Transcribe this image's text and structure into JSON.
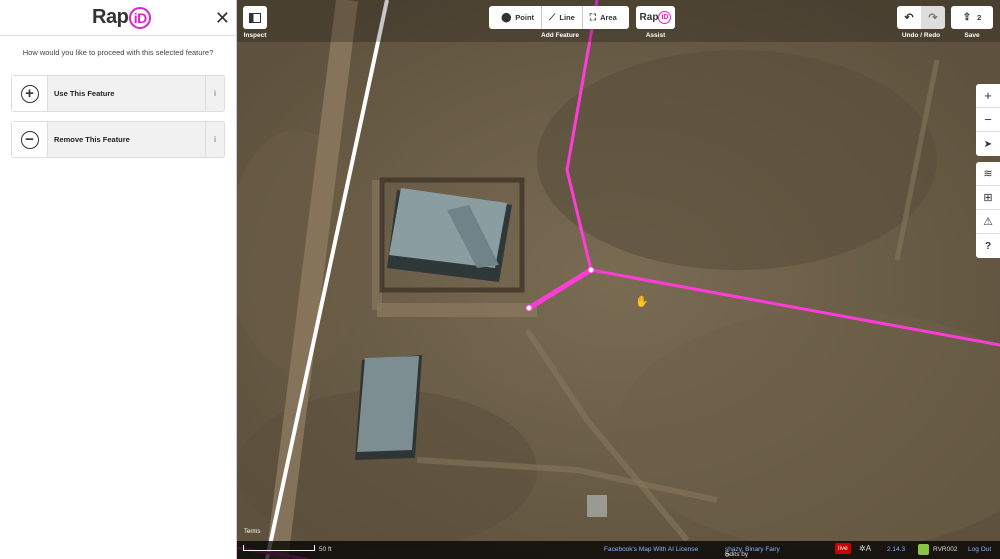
{
  "sidebar": {
    "logo_text": "Rap",
    "logo_id": "iD",
    "close_glyph": "✕",
    "prompt": "How would you like to proceed with this selected feature?",
    "choices": [
      {
        "label": "Use This Feature",
        "glyph": "+",
        "info": "i"
      },
      {
        "label": "Remove This Feature",
        "glyph": "−",
        "info": "i"
      }
    ]
  },
  "toolbar": {
    "inspect_label": "Inspect",
    "add_feature_label": "Add Feature",
    "point_label": "Point",
    "line_label": "Line",
    "area_label": "Area",
    "assist_label": "Assist",
    "assist_logo": "Rap",
    "assist_logo_id": "iD",
    "undo_redo_label": "Undo / Redo",
    "save_label": "Save",
    "save_count": "2"
  },
  "map_controls": {
    "zoom_in": "+",
    "zoom_out": "−"
  },
  "footer": {
    "terms": "Terms",
    "scale": "50 ft",
    "license": "Facebook's Map With AI License",
    "edits_prefix": "Edits by",
    "edits_users": "shazy, Binary Fairy",
    "live": "live",
    "version": "2.14.3",
    "user": "RVR002",
    "logout": "Log Out"
  },
  "colors": {
    "accent": "#e020c8",
    "road": "#ff3cd8"
  }
}
